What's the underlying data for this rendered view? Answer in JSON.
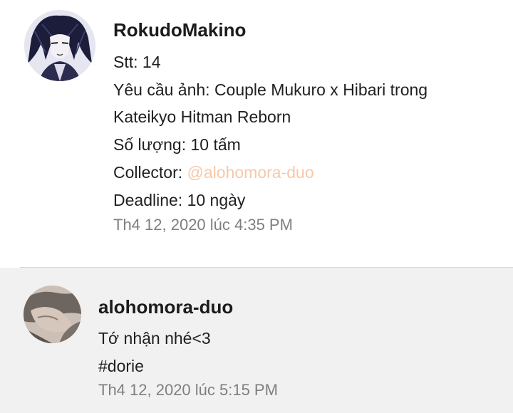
{
  "comments": [
    {
      "author": "RokudoMakino",
      "lines": {
        "stt": "Stt: 14",
        "request_1": "Yêu cầu ảnh: Couple Mukuro x Hibari trong",
        "request_2": "Kateikyo Hitman Reborn",
        "quantity": "Số lượng: 10 tấm",
        "collector_label": "Collector: ",
        "collector_mention": "@alohomora-duo",
        "deadline": "Deadline: 10 ngày"
      },
      "timestamp": "Th4 12, 2020 lúc 4:35 PM"
    },
    {
      "author": "alohomora-duo",
      "lines": {
        "text": "Tớ nhận nhé<3",
        "tag": "#dorie"
      },
      "timestamp": "Th4 12, 2020 lúc 5:15 PM"
    }
  ],
  "colors": {
    "mention": "#f7c8a8",
    "timestamp": "#7f7f7f",
    "second_bg": "#f1f1f1"
  }
}
